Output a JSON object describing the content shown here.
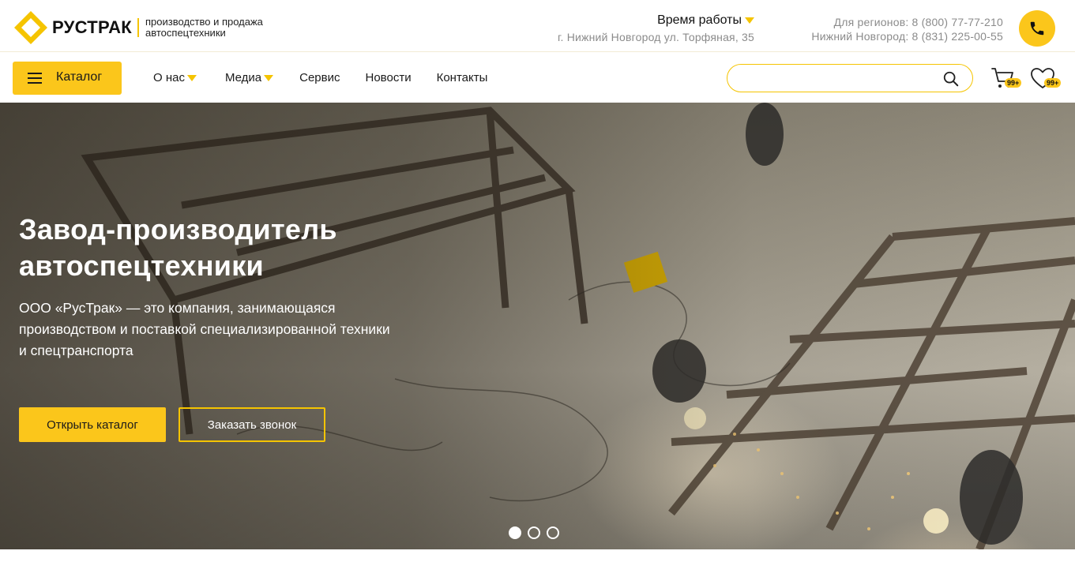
{
  "brand": {
    "name": "РУСТРАК",
    "tagline_line1": "производство и продажа",
    "tagline_line2": "автоспецтехники",
    "accent_color": "#fbc61b"
  },
  "hours": {
    "title": "Время работы",
    "address": "г. Нижний Новгород ул. Торфяная, 35"
  },
  "phones": {
    "regions": "Для регионов: 8 (800) 77-77-210",
    "city": "Нижний Новгород: 8 (831) 225-00-55",
    "call_icon": "phone-icon"
  },
  "nav": {
    "catalog_label": "Каталог",
    "items": [
      {
        "label": "О нас",
        "dropdown": true
      },
      {
        "label": "Медиа",
        "dropdown": true
      },
      {
        "label": "Сервис",
        "dropdown": false
      },
      {
        "label": "Новости",
        "dropdown": false
      },
      {
        "label": "Контакты",
        "dropdown": false
      }
    ]
  },
  "search": {
    "value": "",
    "placeholder": "",
    "icon": "search-icon"
  },
  "cart": {
    "icon": "cart-icon",
    "count": "99+"
  },
  "favorites": {
    "icon": "heart-icon",
    "count": "99+"
  },
  "hero": {
    "title_line1": "Завод-производитель",
    "title_line2": "автоспецтехники",
    "text": "ООО «РусТрак» — это компания, занимающаяся производством и поставкой специализированной техники и спецтранспорта",
    "primary_button": "Открыть каталог",
    "secondary_button": "Заказать звонок",
    "slides_total": 3,
    "active_slide": 1
  }
}
